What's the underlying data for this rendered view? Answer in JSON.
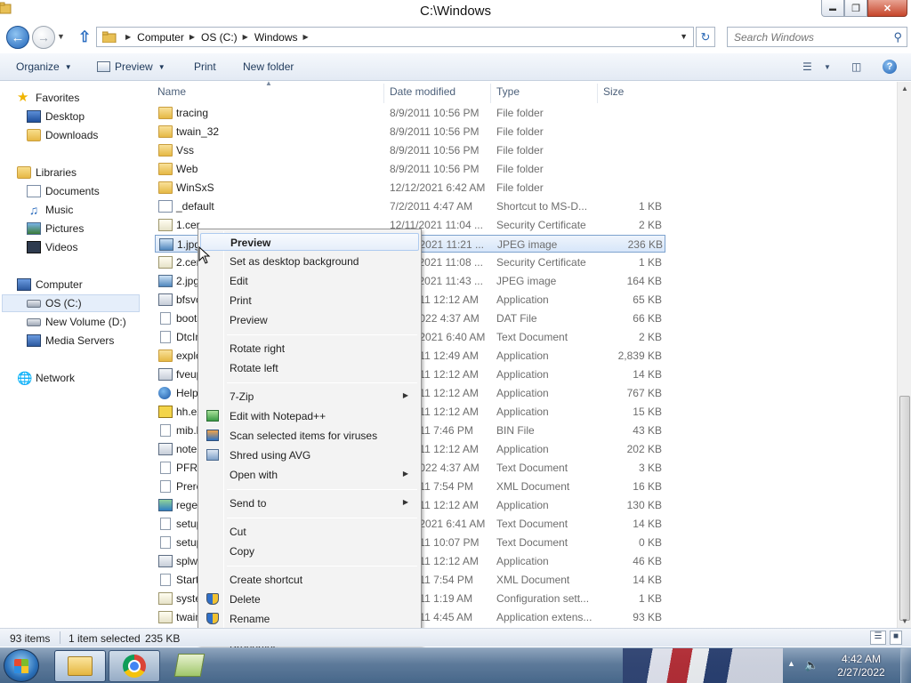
{
  "window": {
    "title": "C:\\Windows",
    "minimize_glyph": "▬",
    "maximize_glyph": "❐",
    "close_glyph": "✕"
  },
  "address": {
    "crumbs": [
      "Computer",
      "OS (C:)",
      "Windows"
    ],
    "search_placeholder": "Search Windows"
  },
  "toolbar": {
    "organize": "Organize",
    "preview": "Preview",
    "print": "Print",
    "new_folder": "New folder"
  },
  "nav": {
    "favorites": "Favorites",
    "desktop": "Desktop",
    "downloads": "Downloads",
    "libraries": "Libraries",
    "documents": "Documents",
    "music": "Music",
    "pictures": "Pictures",
    "videos": "Videos",
    "computer": "Computer",
    "os_c": "OS (C:)",
    "new_volume": "New Volume (D:)",
    "media_servers": "Media Servers",
    "network": "Network"
  },
  "columns": {
    "name": "Name",
    "date": "Date modified",
    "type": "Type",
    "size": "Size"
  },
  "files": [
    {
      "name": "tracing",
      "date": "8/9/2011 10:56 PM",
      "type": "File folder",
      "size": "",
      "icon": "folder-icon"
    },
    {
      "name": "twain_32",
      "date": "8/9/2011 10:56 PM",
      "type": "File folder",
      "size": "",
      "icon": "folder-icon"
    },
    {
      "name": "Vss",
      "date": "8/9/2011 10:56 PM",
      "type": "File folder",
      "size": "",
      "icon": "folder-icon"
    },
    {
      "name": "Web",
      "date": "8/9/2011 10:56 PM",
      "type": "File folder",
      "size": "",
      "icon": "folder-icon"
    },
    {
      "name": "WinSxS",
      "date": "12/12/2021 6:42 AM",
      "type": "File folder",
      "size": "",
      "icon": "folder-icon"
    },
    {
      "name": "_default",
      "date": "7/2/2011 4:47 AM",
      "type": "Shortcut to MS-D...",
      "size": "1 KB",
      "icon": "shortcut-icon"
    },
    {
      "name": "1.cer",
      "date": "12/11/2021 11:04 ...",
      "type": "Security Certificate",
      "size": "2 KB",
      "icon": "certificate-icon"
    },
    {
      "name": "1.jpg",
      "date": "12/11/2021 11:21 ...",
      "type": "JPEG image",
      "size": "236 KB",
      "icon": "image-icon"
    },
    {
      "name": "2.cer",
      "date": "12/11/2021 11:08 ...",
      "type": "Security Certificate",
      "size": "1 KB",
      "icon": "certificate-icon"
    },
    {
      "name": "2.jpg",
      "date": "12/11/2021 11:43 ...",
      "type": "JPEG image",
      "size": "164 KB",
      "icon": "image-icon"
    },
    {
      "name": "bfsvc.exe",
      "date": "8/7/2011 12:12 AM",
      "type": "Application",
      "size": "65 KB",
      "icon": "application-icon"
    },
    {
      "name": "bootstat.dat",
      "date": "2/27/2022 4:37 AM",
      "type": "DAT File",
      "size": "66 KB",
      "icon": "file-icon"
    },
    {
      "name": "DtcInstall.log",
      "date": "12/12/2021 6:40 AM",
      "type": "Text Document",
      "size": "2 KB",
      "icon": "text-file-icon"
    },
    {
      "name": "explorer.exe",
      "date": "8/7/2011 12:49 AM",
      "type": "Application",
      "size": "2,839 KB",
      "icon": "explorer-icon"
    },
    {
      "name": "fveupdate.exe",
      "date": "8/7/2011 12:12 AM",
      "type": "Application",
      "size": "14 KB",
      "icon": "application-icon"
    },
    {
      "name": "HelpPane.exe",
      "date": "8/7/2011 12:12 AM",
      "type": "Application",
      "size": "767 KB",
      "icon": "help-icon"
    },
    {
      "name": "hh.exe",
      "date": "8/7/2011 12:12 AM",
      "type": "Application",
      "size": "15 KB",
      "icon": "help-file-icon"
    },
    {
      "name": "mib.bin",
      "date": "8/6/2011 7:46 PM",
      "type": "BIN File",
      "size": "43 KB",
      "icon": "file-icon"
    },
    {
      "name": "notepad.exe",
      "date": "8/7/2011 12:12 AM",
      "type": "Application",
      "size": "202 KB",
      "icon": "notepad-icon"
    },
    {
      "name": "PFRO.log",
      "date": "2/27/2022 4:37 AM",
      "type": "Text Document",
      "size": "3 KB",
      "icon": "text-file-icon"
    },
    {
      "name": "Prerelease.xml",
      "date": "8/6/2011 7:54 PM",
      "type": "XML Document",
      "size": "16 KB",
      "icon": "xml-file-icon"
    },
    {
      "name": "regedit.exe",
      "date": "8/7/2011 12:12 AM",
      "type": "Application",
      "size": "130 KB",
      "icon": "regedit-icon"
    },
    {
      "name": "setupact.log",
      "date": "12/12/2021 6:41 AM",
      "type": "Text Document",
      "size": "14 KB",
      "icon": "text-file-icon"
    },
    {
      "name": "setuperr.log",
      "date": "8/9/2011 10:07 PM",
      "type": "Text Document",
      "size": "0 KB",
      "icon": "text-file-icon"
    },
    {
      "name": "splwow64.exe",
      "date": "8/7/2011 12:12 AM",
      "type": "Application",
      "size": "46 KB",
      "icon": "application-icon"
    },
    {
      "name": "Starter.xml",
      "date": "8/6/2011 7:54 PM",
      "type": "XML Document",
      "size": "14 KB",
      "icon": "xml-file-icon"
    },
    {
      "name": "system.ini",
      "date": "8/7/2011 1:19 AM",
      "type": "Configuration sett...",
      "size": "1 KB",
      "icon": "config-file-icon"
    },
    {
      "name": "twain.dll",
      "date": "7/2/2011 4:45 AM",
      "type": "Application extens...",
      "size": "93 KB",
      "icon": "dll-icon"
    }
  ],
  "selected_index": 7,
  "context_menu": [
    {
      "label": "Preview",
      "bold": true,
      "highlight": true,
      "submenu": false,
      "icon": ""
    },
    {
      "label": "Set as desktop background",
      "submenu": false,
      "icon": ""
    },
    {
      "label": "Edit",
      "submenu": false,
      "icon": ""
    },
    {
      "label": "Print",
      "submenu": false,
      "icon": ""
    },
    {
      "label": "Preview",
      "submenu": false,
      "icon": ""
    },
    {
      "sep": true
    },
    {
      "label": "Rotate right",
      "submenu": false,
      "icon": ""
    },
    {
      "label": "Rotate left",
      "submenu": false,
      "icon": ""
    },
    {
      "sep": true
    },
    {
      "label": "7-Zip",
      "submenu": true,
      "icon": ""
    },
    {
      "label": "Edit with Notepad++",
      "submenu": false,
      "icon": "notepad-plus-plus-icon"
    },
    {
      "label": "Scan selected items for viruses",
      "submenu": false,
      "icon": "avg-scan-icon"
    },
    {
      "label": "Shred using AVG",
      "submenu": false,
      "icon": "avg-shred-icon"
    },
    {
      "label": "Open with",
      "submenu": true,
      "icon": ""
    },
    {
      "sep": true
    },
    {
      "label": "Send to",
      "submenu": true,
      "icon": ""
    },
    {
      "sep": true
    },
    {
      "label": "Cut",
      "submenu": false,
      "icon": ""
    },
    {
      "label": "Copy",
      "submenu": false,
      "icon": ""
    },
    {
      "sep": true
    },
    {
      "label": "Create shortcut",
      "submenu": false,
      "icon": ""
    },
    {
      "label": "Delete",
      "submenu": false,
      "icon": "uac-shield-icon"
    },
    {
      "label": "Rename",
      "submenu": false,
      "icon": "uac-shield-icon"
    },
    {
      "sep": true
    },
    {
      "label": "Properties",
      "submenu": false,
      "icon": ""
    }
  ],
  "status": {
    "items": "93 items",
    "selection": "1 item selected",
    "size": "235 KB"
  },
  "taskbar": {
    "time": "4:42 AM",
    "date": "2/27/2022"
  }
}
